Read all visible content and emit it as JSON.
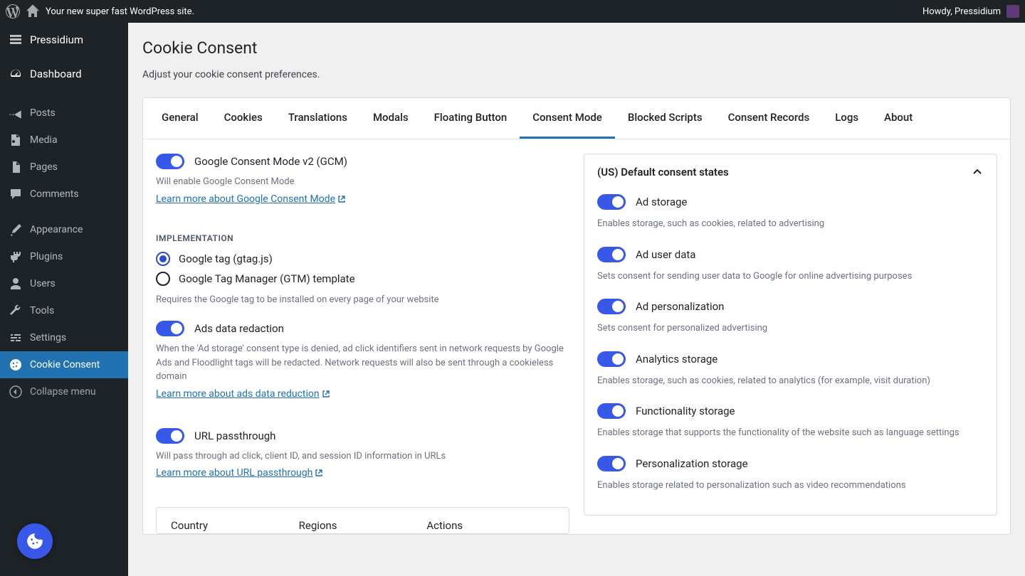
{
  "topbar": {
    "site_name": "Your new super fast WordPress site.",
    "greeting": "Howdy, Pressidium"
  },
  "sidebar": {
    "items": [
      {
        "label": "Pressidium",
        "icon": "pressidium"
      },
      {
        "label": "Dashboard",
        "icon": "dashboard"
      },
      {
        "label": "Posts",
        "icon": "pin"
      },
      {
        "label": "Media",
        "icon": "media"
      },
      {
        "label": "Pages",
        "icon": "page"
      },
      {
        "label": "Comments",
        "icon": "comment"
      },
      {
        "label": "Appearance",
        "icon": "brush"
      },
      {
        "label": "Plugins",
        "icon": "plug"
      },
      {
        "label": "Users",
        "icon": "user"
      },
      {
        "label": "Tools",
        "icon": "wrench"
      },
      {
        "label": "Settings",
        "icon": "sliders"
      },
      {
        "label": "Cookie Consent",
        "icon": "cookie",
        "active": true
      },
      {
        "label": "Collapse menu",
        "icon": "collapse",
        "collapse": true
      }
    ]
  },
  "page": {
    "title": "Cookie Consent",
    "subtitle": "Adjust your cookie consent preferences."
  },
  "tabs": [
    "General",
    "Cookies",
    "Translations",
    "Modals",
    "Floating Button",
    "Consent Mode",
    "Blocked Scripts",
    "Consent Records",
    "Logs",
    "About"
  ],
  "active_tab": "Consent Mode",
  "left": {
    "gcm": {
      "label": "Google Consent Mode v2 (GCM)",
      "desc": "Will enable Google Consent Mode",
      "link": "Learn more about Google Consent Mode"
    },
    "impl_heading": "IMPLEMENTATION",
    "impl_options": [
      "Google tag (gtag.js)",
      "Google Tag Manager (GTM) template"
    ],
    "impl_desc": "Requires the Google tag to be installed on every page of your website",
    "ads_redaction": {
      "label": "Ads data redaction",
      "desc": "When the 'Ad storage' consent type is denied, ad click identifiers sent in network requests by Google Ads and Floodlight tags will be redacted. Network requests will also be sent through a cookieless domain",
      "link": "Learn more about ads data reduction"
    },
    "url_pass": {
      "label": "URL passthrough",
      "desc": "Will pass through ad click, client ID, and session ID information in URLs",
      "link": "Learn more about URL passthrough"
    },
    "table": {
      "cols": [
        "Country",
        "Regions",
        "Actions"
      ]
    }
  },
  "right": {
    "card_title": "(US) Default consent states",
    "items": [
      {
        "label": "Ad storage",
        "desc": "Enables storage, such as cookies, related to advertising"
      },
      {
        "label": "Ad user data",
        "desc": "Sets consent for sending user data to Google for online advertising purposes"
      },
      {
        "label": "Ad personalization",
        "desc": "Sets consent for personalized advertising"
      },
      {
        "label": "Analytics storage",
        "desc": "Enables storage, such as cookies, related to analytics (for example, visit duration)"
      },
      {
        "label": "Functionality storage",
        "desc": "Enables storage that supports the functionality of the website such as language settings"
      },
      {
        "label": "Personalization storage",
        "desc": "Enables storage related to personalization such as video recommendations"
      }
    ]
  }
}
